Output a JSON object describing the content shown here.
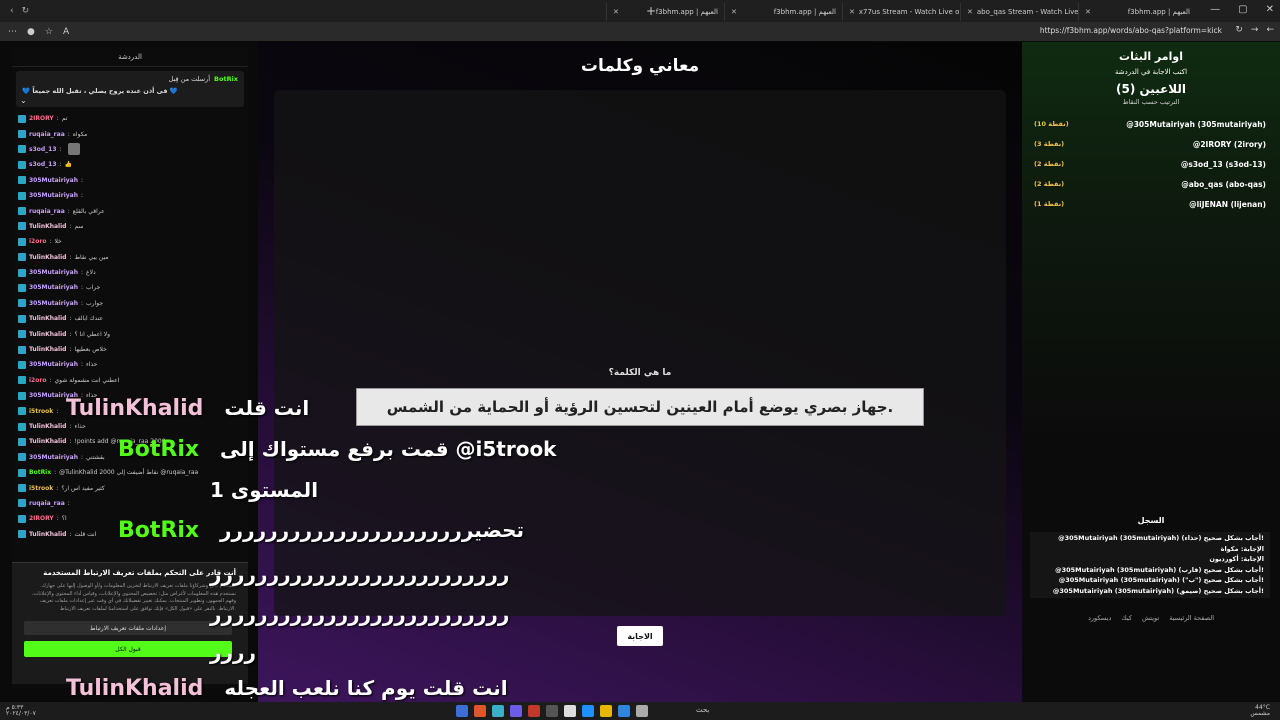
{
  "browser": {
    "tabs": [
      {
        "label": "f3bhm.app | العبهم"
      },
      {
        "label": "f3bhm.app | العبهم"
      },
      {
        "label": "x77us Stream - Watch Live on Kick"
      },
      {
        "label": "abo_qas Stream - Watch Live on Kick"
      },
      {
        "label": "f3bhm.app | العبهم"
      }
    ],
    "url": "https://f3bhm.app/words/abo-qas?platform=kick"
  },
  "chat": {
    "header": "الدردشة",
    "pinned": {
      "by": "أرسلت من قِبل",
      "user": "BotRix",
      "text": "💙 فى أذن عنده يروح يصلي ، تقبل الله جميعاً 💙"
    },
    "messages": [
      {
        "user": "2IRORY",
        "text": "تم",
        "color": "#ff6b8a"
      },
      {
        "user": "ruqaia_raa",
        "text": "مكواه",
        "color": "#c9a0ff"
      },
      {
        "user": "s3od_13",
        "text": "",
        "color": "#c9a0ff",
        "emote": true
      },
      {
        "user": "s3od_13",
        "text": "👍",
        "color": "#c9a0ff"
      },
      {
        "user": "305Mutairiyah",
        "text": "",
        "color": "#c9a0ff"
      },
      {
        "user": "305Mutairiyah",
        "text": "",
        "color": "#c9a0ff"
      },
      {
        "user": "ruqaia_raa",
        "text": "عراقي بالقلع",
        "color": "#c9a0ff"
      },
      {
        "user": "TulinKhalid",
        "text": "سم",
        "color": "#f3c1d8"
      },
      {
        "user": "i2oro",
        "text": "خلا",
        "color": "#ff6b8a"
      },
      {
        "user": "TulinKhalid",
        "text": "مين يبي نقاط",
        "color": "#f3c1d8"
      },
      {
        "user": "305Mutairiyah",
        "text": "دلاغ",
        "color": "#c9a0ff"
      },
      {
        "user": "305Mutairiyah",
        "text": "جراب",
        "color": "#c9a0ff"
      },
      {
        "user": "305Mutairiyah",
        "text": "جوارب",
        "color": "#c9a0ff"
      },
      {
        "user": "TulinKhalid",
        "text": "عندك ابالف",
        "color": "#f3c1d8"
      },
      {
        "user": "TulinKhalid",
        "text": "ولا اعطي انا ؟",
        "color": "#f3c1d8"
      },
      {
        "user": "TulinKhalid",
        "text": "خلاص بعطيها",
        "color": "#f3c1d8"
      },
      {
        "user": "305Mutairiyah",
        "text": "حذاء",
        "color": "#c9a0ff"
      },
      {
        "user": "i2oro",
        "text": "اعطني انت مشمولة شوي",
        "color": "#ff6b8a"
      },
      {
        "user": "305Mutairiyah",
        "text": "حذاء",
        "color": "#c9a0ff"
      },
      {
        "user": "i5trook",
        "text": "",
        "color": "#f2c14e"
      },
      {
        "user": "TulinKhalid",
        "text": "حذاء",
        "color": "#f3c1d8"
      },
      {
        "user": "TulinKhalid",
        "text": "!points add @ruqaia_raa 2000",
        "color": "#f3c1d8"
      },
      {
        "user": "305Mutairiyah",
        "text": "بقشتني",
        "color": "#c9a0ff"
      },
      {
        "user": "BotRix",
        "text": "@TulinKhalid 2000 نقاط أضيفت إلى @ruqaia_raa",
        "color": "#53fc18"
      },
      {
        "user": "i5trook",
        "text": "كثير مفيد اس ار؟",
        "color": "#f2c14e"
      },
      {
        "user": "ruqaia_raa",
        "text": "",
        "color": "#c9a0ff"
      },
      {
        "user": "2IRORY",
        "text": "ا؟",
        "color": "#ff6b8a"
      },
      {
        "user": "TulinKhalid",
        "text": "انت قلت",
        "color": "#f3c1d8"
      }
    ]
  },
  "cookie": {
    "title": "أنت قادر على التحكم بملفات تعريف الارتباط المستخدمة",
    "body": "نستخدم نحن وشركاؤنا ملفات تعريف الارتباط لتخزين المعلومات و/أو الوصول إليها على جهازك. نستخدم هذه المعلومات لأغراض مثل: تخصيص المحتوى والإعلانات، وقياس أداء المحتوى والإعلانات، وفهم الجمهور، وتطوير المنتجات. يمكنك تغيير تفضيلاتك في أي وقت عبر إعدادات ملفات تعريف الارتباط. بالنقر على «قبول الكل» فإنك توافق على استخدامنا لملفات تعريف الارتباط.",
    "settings": "إعدادات ملفات تعريف الارتباط",
    "accept": "قبول الكل"
  },
  "game": {
    "title": "معاني وكلمات",
    "question_label": "ما هي الكلمة؟",
    "question": "جهاز بصري يوضع أمام العينين لتحسين الرؤية أو الحماية من الشمس.",
    "answer_button": "الاجابة"
  },
  "sidebar": {
    "title": "اوامر البثات",
    "instruction": "اكتب الاجابة في الدردشة",
    "players": "اللاعبين (5)",
    "sort": "الترتيب حسب النقاط",
    "leaderboard": [
      {
        "name": "@305Mutairiyah (305mutairiyah)",
        "points": "(10 نقطة)"
      },
      {
        "name": "@2IRORY (2irory)",
        "points": "(3 نقطة)"
      },
      {
        "name": "@s3od_13 (s3od-13)",
        "points": "(2 نقطة)"
      },
      {
        "name": "@abo_qas (abo-qas)",
        "points": "(2 نقطة)"
      },
      {
        "name": "@liJENAN (lijenan)",
        "points": "(1 نقطة)"
      }
    ],
    "log_title": "السجل",
    "log": [
      "@305Mutairiyah (305mutairiyah) أجاب بشكل صحيح (حذاء)!",
      "الإجابة: مكواة",
      "الإجابة: أكورديون",
      "@305Mutairiyah (305mutairiyah) أجاب بشكل صحيح (قارب)!",
      "@305Mutairiyah (305mutairiyah) أجاب بشكل صحيح (\"ب\")!",
      "@305Mutairiyah (305mutairiyah) أجاب بشكل صحيح (صيمق)!"
    ],
    "footer": [
      "الصفحة الرئيسية",
      "تويتش",
      "كيك",
      "ديسكورد"
    ]
  },
  "overlay": {
    "line1_name": "TulinKhalid",
    "line1_text": "انت قلت",
    "line2_name": "BotRix",
    "line2_text": "قمت برفع مستواك إلى @i5trook",
    "line2b_text": "المستوى 1",
    "line3_name": "BotRix",
    "line3_text": "تحضيرررررررررررررررررررررر",
    "line4_text": "رررررررررررررررررررررررررر",
    "line5_text": "رررررررررررررررررررررررررر",
    "line6_text": "رررر",
    "line7_name": "TulinKhalid",
    "line7_text": "انت قلت يوم كنا نلعب العجله"
  },
  "taskbar": {
    "search": "بحث",
    "time": "٥:٣٣ م",
    "date": "٢٠٢٤/٠٣/٠٧",
    "weather": "44°C",
    "weather_desc": "مشمس"
  }
}
